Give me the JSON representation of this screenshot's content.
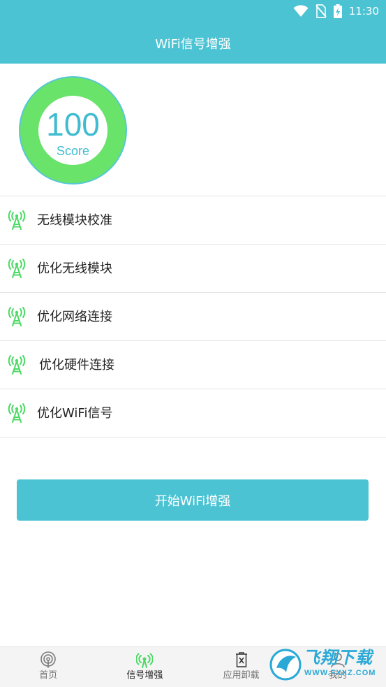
{
  "status_bar": {
    "time": "11:30",
    "icons": [
      "wifi-icon",
      "no-sim-icon",
      "battery-charging-icon"
    ]
  },
  "app_bar": {
    "title": "WiFi信号增强"
  },
  "score": {
    "value": "100",
    "label": "Score"
  },
  "colors": {
    "primary": "#4cc3d3",
    "ring": "#6ae36a",
    "score_text": "#3fbcd0",
    "tower_icon": "#4cd964"
  },
  "list": {
    "icon": "signal-tower-icon",
    "items": [
      {
        "label": "无线模块校准"
      },
      {
        "label": "优化无线模块"
      },
      {
        "label": "优化网络连接"
      },
      {
        "label": "优化硬件连接"
      },
      {
        "label": "优化WiFi信号"
      }
    ]
  },
  "start_button": {
    "label": "开始WiFi增强"
  },
  "tab_bar": {
    "active_index": 1,
    "tabs": [
      {
        "label": "首页",
        "icon": "home-signal-icon"
      },
      {
        "label": "信号增强",
        "icon": "signal-tower-icon"
      },
      {
        "label": "应用卸载",
        "icon": "trash-icon"
      },
      {
        "label": "我的",
        "icon": "profile-icon"
      }
    ]
  },
  "watermark": {
    "title": "飞翔下载",
    "url": "WWW.FXXZ.COM"
  }
}
